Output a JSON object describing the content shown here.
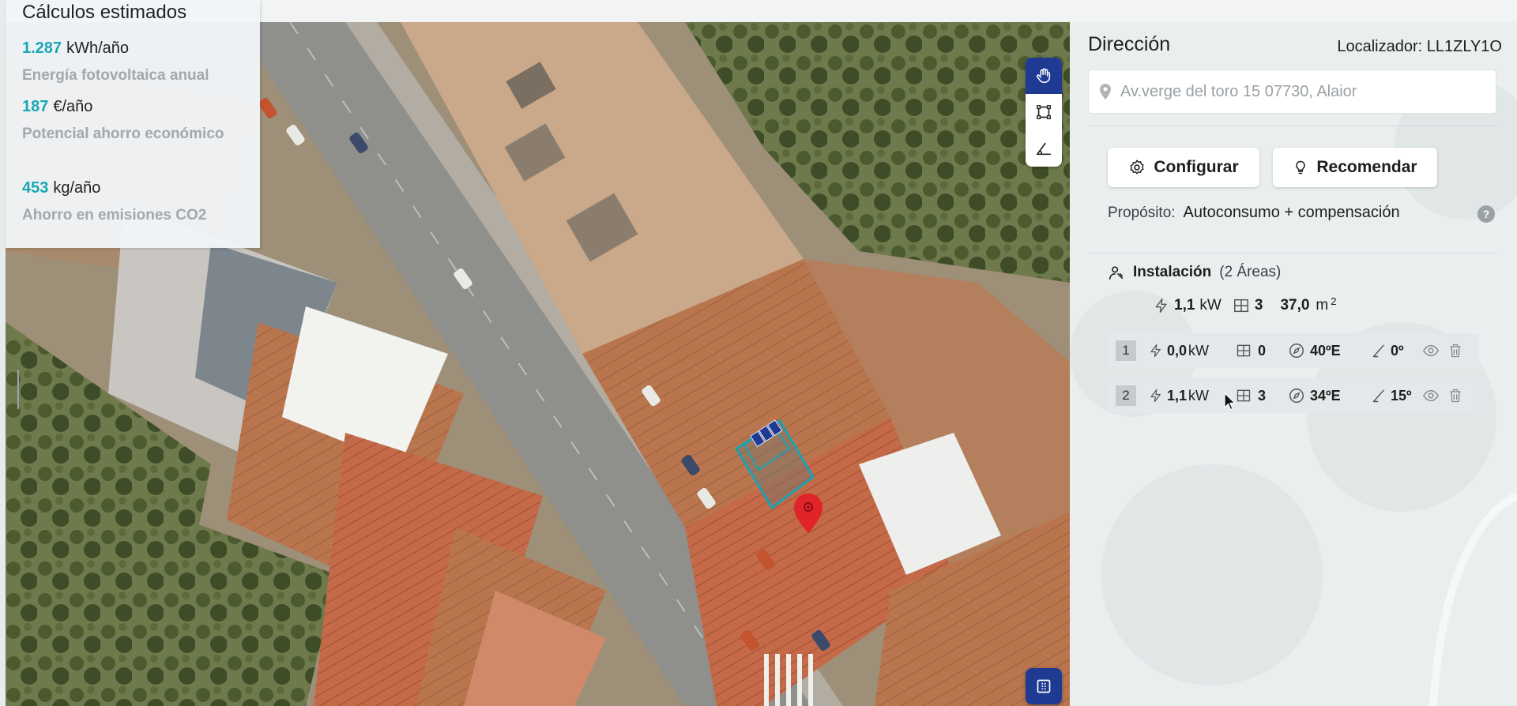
{
  "estimates": {
    "title": "Cálculos estimados",
    "items": [
      {
        "value": "1.287",
        "unit": "kWh/año",
        "description": "Energía fotovoltaica anual"
      },
      {
        "value": "187",
        "unit": "€/año",
        "description": "Potencial ahorro económico"
      },
      {
        "value": "453",
        "unit": "kg/año",
        "description": "Ahorro en emisiones CO2"
      }
    ]
  },
  "map": {
    "tools": [
      {
        "icon": "hand-icon",
        "active": true
      },
      {
        "icon": "draw-area-icon",
        "active": false
      },
      {
        "icon": "measure-icon",
        "active": false
      }
    ],
    "fab_icon": "panel-grid-icon",
    "marker_icon": "map-pin-icon"
  },
  "panel": {
    "title": "Dirección",
    "locator": "Localizador: LL1ZLY1O",
    "address": {
      "value": "",
      "placeholder": "Av.verge del toro 15 07730, Alaior"
    },
    "configure_label": "Configurar",
    "recommend_label": "Recomendar",
    "purpose_label": "Propósito:",
    "purpose_value": "Autoconsumo + compensación",
    "help_label": "?",
    "installation": {
      "label": "Instalación",
      "areas_count": "(2 Áreas)",
      "power_value": "1,1",
      "power_unit": "kW",
      "modules": "3",
      "surface_value": "37,0",
      "surface_unit": "m",
      "surface_exp": "2"
    },
    "areas": [
      {
        "index": "1",
        "power": "0,0",
        "power_unit": "kW",
        "modules": "0",
        "orientation": "40ºE",
        "tilt": "0º"
      },
      {
        "index": "2",
        "power": "1,1",
        "power_unit": "kW",
        "modules": "3",
        "orientation": "34ºE",
        "tilt": "15º"
      }
    ]
  },
  "colors": {
    "accent": "#1aa7b3",
    "primary": "#1f3a93",
    "marker": "#e0242a"
  }
}
